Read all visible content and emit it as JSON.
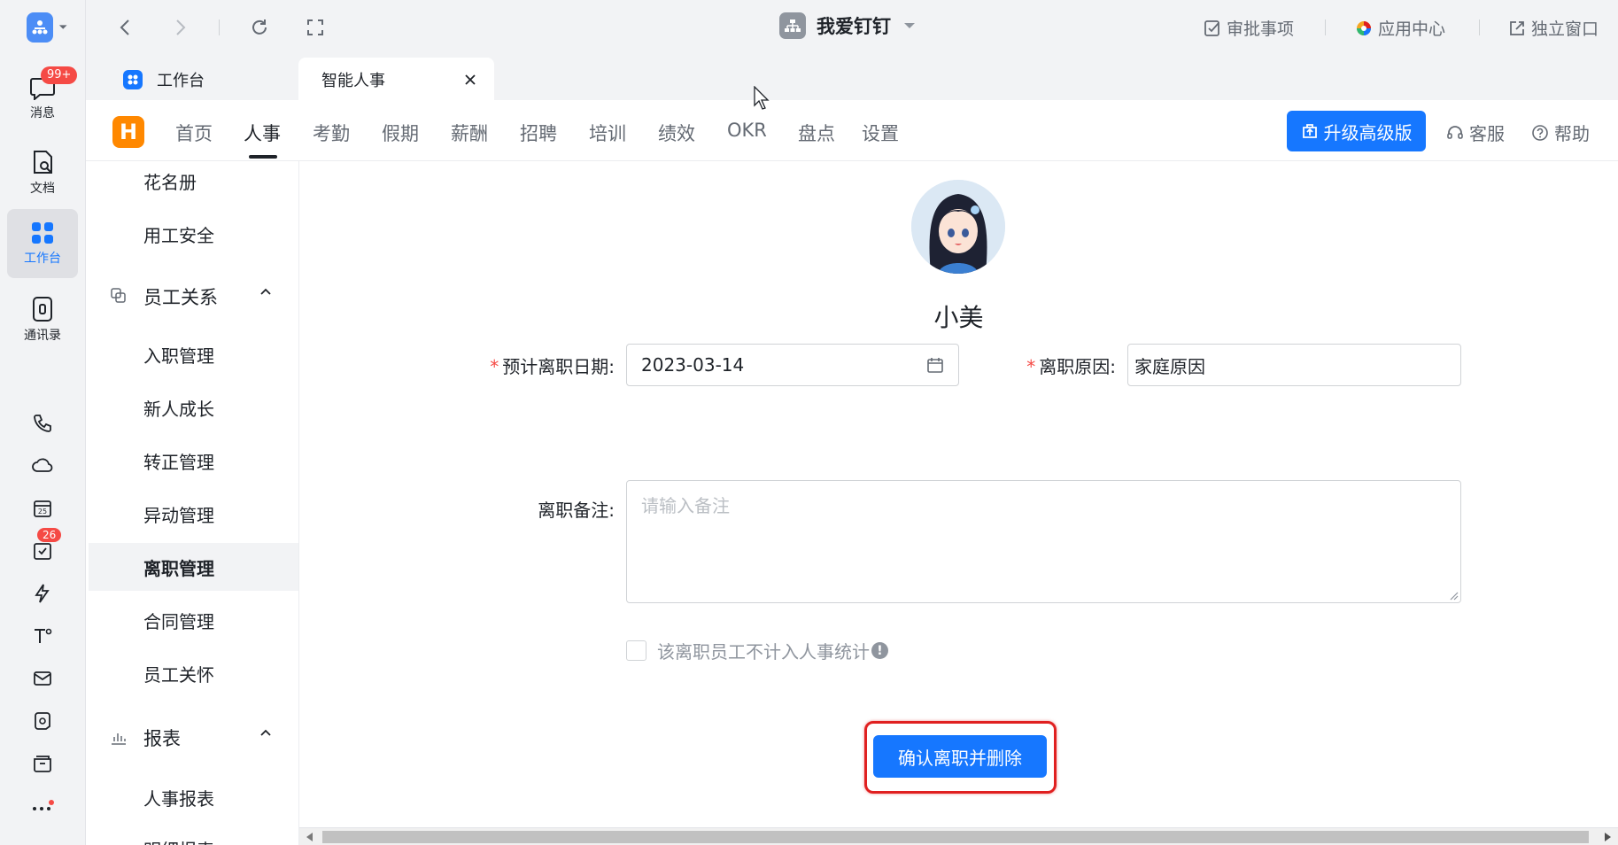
{
  "rail": {
    "messages_label": "消息",
    "messages_badge": "99+",
    "docs_label": "文档",
    "workbench_label": "工作台",
    "contacts_label": "通讯录",
    "todo_badge": "26"
  },
  "topbar": {
    "title": "我爱钉钉",
    "approvals": "审批事项",
    "app_center": "应用中心",
    "standalone": "独立窗口"
  },
  "tabs": [
    {
      "label": "工作台"
    },
    {
      "label": "智能人事"
    }
  ],
  "nav": {
    "items": [
      "首页",
      "人事",
      "考勤",
      "假期",
      "薪酬",
      "招聘",
      "培训",
      "绩效",
      "OKR",
      "盘点",
      "设置"
    ],
    "active": "人事",
    "upgrade": "升级高级版",
    "support": "客服",
    "help": "帮助"
  },
  "sidebar": {
    "roster": "花名册",
    "safety": "用工安全",
    "group_relations": "员工关系",
    "onboarding": "入职管理",
    "growth": "新人成长",
    "regularization": "转正管理",
    "transfer": "异动管理",
    "resignation": "离职管理",
    "contract": "合同管理",
    "care": "员工关怀",
    "group_reports": "报表",
    "hr_report": "人事报表",
    "detail_report": "明细报表"
  },
  "form": {
    "employee_name": "小美",
    "date_label": "预计离职日期:",
    "date_value": "2023-03-14",
    "reason_label": "离职原因:",
    "reason_value": "家庭原因",
    "remark_label": "离职备注:",
    "remark_placeholder": "请输入备注",
    "exclude_label": "该离职员工不计入人事统计",
    "confirm_button": "确认离职并删除"
  }
}
